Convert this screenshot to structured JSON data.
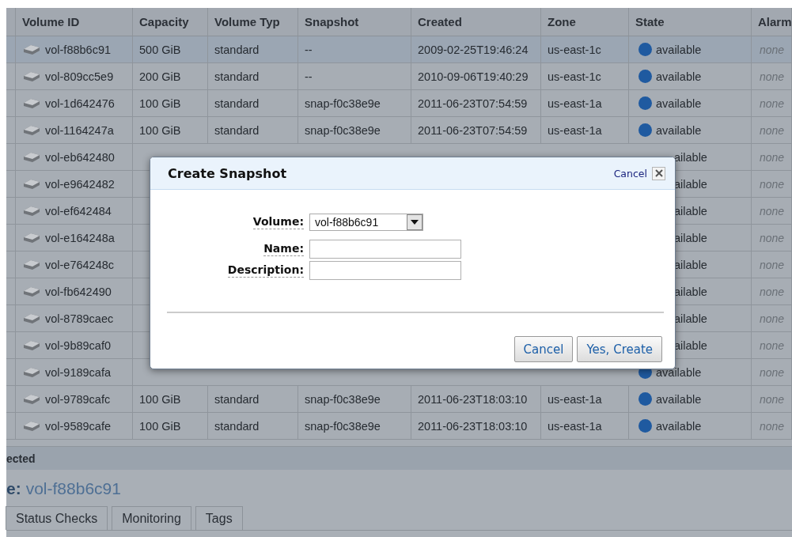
{
  "table": {
    "columns": [
      "Volume ID",
      "Capacity",
      "Volume Typ",
      "Snapshot",
      "Created",
      "Zone",
      "State",
      "Alarm"
    ],
    "rows": [
      {
        "kind": "full",
        "selected": true,
        "volume_id": "vol-f88b6c91",
        "capacity": "500 GiB",
        "type": "standard",
        "snapshot": "--",
        "created": "2009-02-25T19:46:24",
        "zone": "us-east-1c",
        "state": "available",
        "alarm": "none"
      },
      {
        "kind": "full",
        "selected": false,
        "volume_id": "vol-809cc5e9",
        "capacity": "200 GiB",
        "type": "standard",
        "snapshot": "--",
        "created": "2010-09-06T19:40:29",
        "zone": "us-east-1c",
        "state": "available",
        "alarm": "none"
      },
      {
        "kind": "full",
        "selected": false,
        "volume_id": "vol-1d642476",
        "capacity": "100 GiB",
        "type": "standard",
        "snapshot": "snap-f0c38e9e",
        "created": "2011-06-23T07:54:59",
        "zone": "us-east-1a",
        "state": "available",
        "alarm": "none"
      },
      {
        "kind": "full",
        "selected": false,
        "volume_id": "vol-1164247a",
        "capacity": "100 GiB",
        "type": "standard",
        "snapshot": "snap-f0c38e9e",
        "created": "2011-06-23T07:54:59",
        "zone": "us-east-1a",
        "state": "available",
        "alarm": "none"
      },
      {
        "kind": "covered",
        "selected": false,
        "volume_id": "vol-eb642480",
        "state": "ailable",
        "alarm": "none"
      },
      {
        "kind": "covered",
        "selected": false,
        "volume_id": "vol-e9642482",
        "state": "ailable",
        "alarm": "none"
      },
      {
        "kind": "covered",
        "selected": false,
        "volume_id": "vol-ef642484",
        "state": "ailable",
        "alarm": "none"
      },
      {
        "kind": "covered",
        "selected": false,
        "volume_id": "vol-e164248a",
        "state": "ailable",
        "alarm": "none"
      },
      {
        "kind": "covered",
        "selected": false,
        "volume_id": "vol-e764248c",
        "state": "ailable",
        "alarm": "none"
      },
      {
        "kind": "covered",
        "selected": false,
        "volume_id": "vol-fb642490",
        "state": "ailable",
        "alarm": "none"
      },
      {
        "kind": "covered",
        "selected": false,
        "volume_id": "vol-8789caec",
        "state": "ailable",
        "alarm": "none"
      },
      {
        "kind": "covered",
        "selected": false,
        "volume_id": "vol-9b89caf0",
        "state": "ailable",
        "alarm": "none"
      },
      {
        "kind": "partial",
        "selected": false,
        "volume_id": "vol-9189cafa",
        "state": "available",
        "alarm": "none"
      },
      {
        "kind": "full",
        "selected": false,
        "volume_id": "vol-9789cafc",
        "capacity": "100 GiB",
        "type": "standard",
        "snapshot": "snap-f0c38e9e",
        "created": "2011-06-23T18:03:10",
        "zone": "us-east-1a",
        "state": "available",
        "alarm": "none"
      },
      {
        "kind": "full",
        "selected": false,
        "volume_id": "vol-9589cafe",
        "capacity": "100 GiB",
        "type": "standard",
        "snapshot": "snap-f0c38e9e",
        "created": "2011-06-23T18:03:10",
        "zone": "us-east-1a",
        "state": "available",
        "alarm": "none"
      }
    ]
  },
  "details": {
    "bar_title": "ected",
    "label": "e:",
    "volume": "vol-f88b6c91",
    "tabs": [
      "Status Checks",
      "Monitoring",
      "Tags"
    ]
  },
  "dialog": {
    "title": "Create Snapshot",
    "cancel_link": "Cancel",
    "fields": [
      {
        "kind": "select",
        "label": "Volume:",
        "value": "vol-f88b6c91"
      },
      {
        "kind": "text",
        "label": "Name:"
      },
      {
        "kind": "text",
        "label": "Description:"
      }
    ],
    "buttons": [
      "Cancel",
      "Yes, Create"
    ]
  }
}
